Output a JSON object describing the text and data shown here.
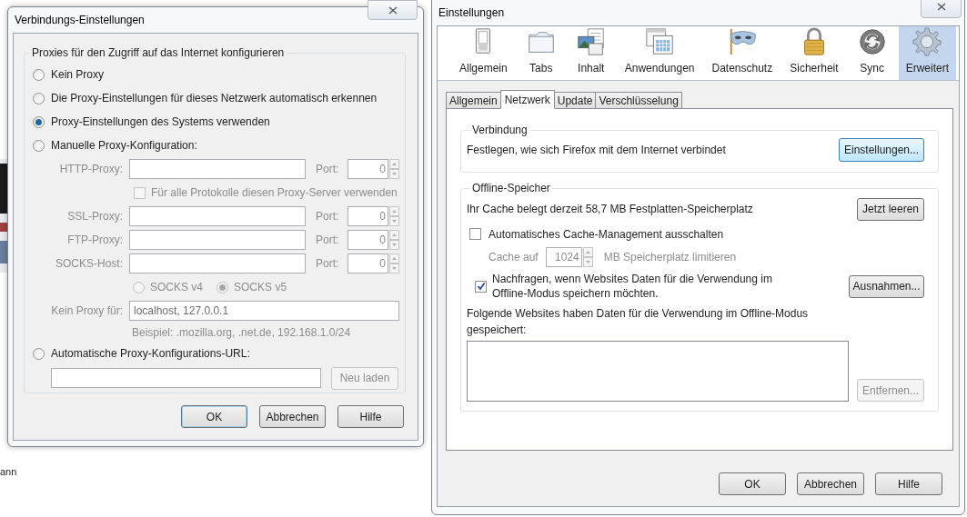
{
  "background_text": [
    "ann"
  ],
  "connection_dialog": {
    "title": "Verbindungs-Einstellungen",
    "group_title": "Proxies für den Zugriff auf das Internet konfigurieren",
    "modes": [
      {
        "label": "Kein Proxy",
        "selected": false
      },
      {
        "label": "Die Proxy-Einstellungen für dieses Netzwerk automatisch erkennen",
        "selected": false
      },
      {
        "label": "Proxy-Einstellungen des Systems verwenden",
        "selected": true
      },
      {
        "label": "Manuelle Proxy-Konfiguration:",
        "selected": false
      }
    ],
    "proxies": [
      {
        "label": "HTTP-Proxy:",
        "port_label": "Port:",
        "port": "0",
        "disabled": true
      },
      {
        "label": "SSL-Proxy:",
        "port_label": "Port:",
        "port": "0",
        "disabled": true
      },
      {
        "label": "FTP-Proxy:",
        "port_label": "Port:",
        "port": "0",
        "disabled": true
      },
      {
        "label": "SOCKS-Host:",
        "port_label": "Port:",
        "port": "0",
        "disabled": true
      }
    ],
    "share_all": {
      "label": "Für alle Protokolle diesen Proxy-Server verwenden",
      "checked": false,
      "disabled": true
    },
    "socks_versions": [
      {
        "label": "SOCKS v4",
        "selected": false,
        "disabled": true
      },
      {
        "label": "SOCKS v5",
        "selected": true,
        "disabled": true
      }
    ],
    "no_proxy": {
      "label": "Kein Proxy für:",
      "value": "localhost, 127.0.0.1",
      "disabled": true
    },
    "example": "Beispiel: .mozilla.org, .net.de, 192.168.1.0/24",
    "auto_url": {
      "label": "Automatische Proxy-Konfigurations-URL:",
      "selected": false
    },
    "reload_button": {
      "label": "Neu laden",
      "disabled": true
    },
    "buttons": [
      {
        "label": "OK",
        "default": true
      },
      {
        "label": "Abbrechen",
        "default": false
      },
      {
        "label": "Hilfe",
        "default": false
      }
    ]
  },
  "preferences_window": {
    "title": "Einstellungen",
    "categories": [
      {
        "label": "Allgemein",
        "kind": "general",
        "selected": false
      },
      {
        "label": "Tabs",
        "kind": "tabs",
        "selected": false
      },
      {
        "label": "Inhalt",
        "kind": "content",
        "selected": false
      },
      {
        "label": "Anwendungen",
        "kind": "applications",
        "selected": false
      },
      {
        "label": "Datenschutz",
        "kind": "privacy",
        "selected": false
      },
      {
        "label": "Sicherheit",
        "kind": "security",
        "selected": false
      },
      {
        "label": "Sync",
        "kind": "sync",
        "selected": false
      },
      {
        "label": "Erweitert",
        "kind": "advanced",
        "selected": true
      }
    ],
    "tabs": [
      {
        "label": "Allgemein",
        "selected": false
      },
      {
        "label": "Netzwerk",
        "selected": true
      },
      {
        "label": "Update",
        "selected": false
      },
      {
        "label": "Verschlüsselung",
        "selected": false
      }
    ],
    "connection": {
      "title": "Verbindung",
      "text": "Festlegen, wie sich Firefox mit dem Internet verbindet",
      "button": "Einstellungen..."
    },
    "offline": {
      "title": "Offline-Speicher",
      "cache_text": "Ihr Cache belegt derzeit 58,7 MB Festplatten-Speicherplatz",
      "clear_button": "Jetzt leeren",
      "auto_manage": {
        "label": "Automatisches Cache-Management ausschalten",
        "checked": false
      },
      "limit": {
        "label": "Cache auf",
        "value": "1024",
        "unit": "MB Speicherplatz limitieren",
        "disabled": true
      },
      "ask": {
        "label": "Nachfragen, wenn Websites Daten für die Verwendung im Offline-Modus speichern möchten.",
        "checked": true
      },
      "exceptions_button": "Ausnahmen...",
      "list_label": "Folgende Websites haben Daten für die Verwendung im Offline-Modus gespeichert:",
      "remove_button": {
        "label": "Entfernen...",
        "disabled": true
      }
    },
    "buttons": [
      "OK",
      "Abbrechen",
      "Hilfe"
    ]
  }
}
